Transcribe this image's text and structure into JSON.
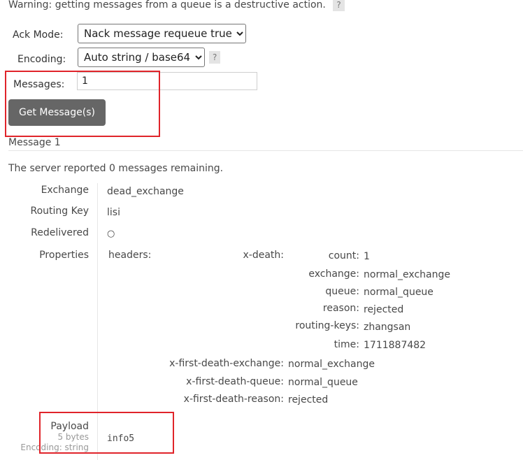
{
  "warning": {
    "text": "Warning: getting messages from a queue is a destructive action.",
    "help": "?"
  },
  "form": {
    "ack_mode_label": "Ack Mode:",
    "ack_mode_value": "Nack message requeue true",
    "encoding_label": "Encoding:",
    "encoding_value": "Auto string / base64",
    "encoding_help": "?",
    "messages_label": "Messages:",
    "messages_value": "1",
    "get_button": "Get Message(s)"
  },
  "message": {
    "title": "Message 1",
    "remaining": "The server reported 0 messages remaining.",
    "exchange_label": "Exchange",
    "exchange_value": "dead_exchange",
    "routing_key_label": "Routing Key",
    "routing_key_value": "lisi",
    "redelivered_label": "Redelivered",
    "redelivered_value": "○",
    "properties_label": "Properties",
    "headers_label": "headers:",
    "x_death_label": "x-death:",
    "x_death": [
      {
        "key": "count:",
        "value": "1"
      },
      {
        "key": "exchange:",
        "value": "normal_exchange"
      },
      {
        "key": "queue:",
        "value": "normal_queue"
      },
      {
        "key": "reason:",
        "value": "rejected"
      },
      {
        "key": "routing-keys:",
        "value": "zhangsan"
      },
      {
        "key": "time:",
        "value": "1711887482"
      }
    ],
    "first_death": [
      {
        "key": "x-first-death-exchange:",
        "value": "normal_exchange"
      },
      {
        "key": "x-first-death-queue:",
        "value": "normal_queue"
      },
      {
        "key": "x-first-death-reason:",
        "value": "rejected"
      }
    ],
    "payload_label": "Payload",
    "payload_size": "5 bytes",
    "payload_encoding": "Encoding: string",
    "payload_value": "info5"
  },
  "colors": {
    "button_bg": "#666666",
    "highlight_box": "#e0242a"
  }
}
